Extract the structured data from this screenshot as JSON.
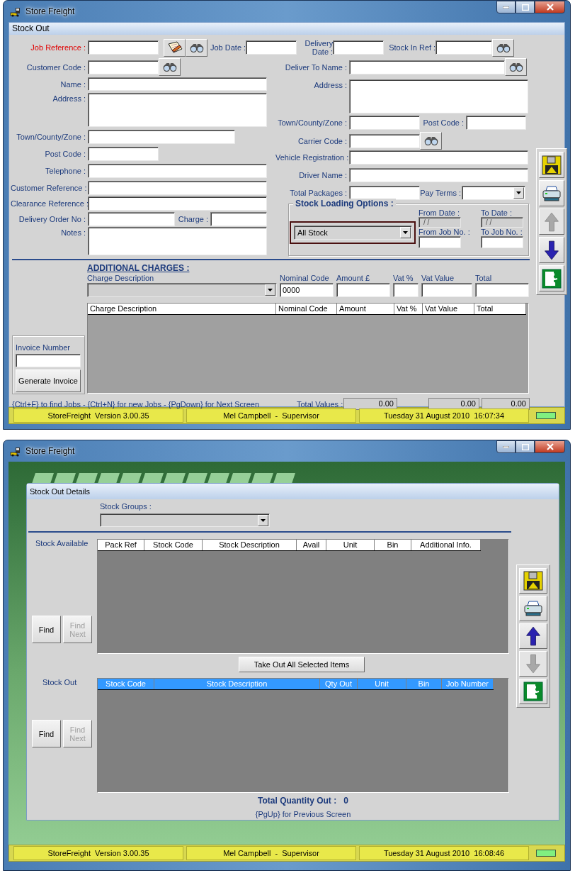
{
  "top_window": {
    "title": "Store Freight",
    "form_title": "Stock Out",
    "left_fields": [
      {
        "label": "Job Reference :",
        "required": true
      },
      {
        "label": "Customer Code :",
        "required": false
      },
      {
        "label": "Name :",
        "required": false
      },
      {
        "label": "Address :",
        "required": false
      },
      {
        "label": "Town/County/Zone :",
        "required": false
      },
      {
        "label": "Post Code :",
        "required": false
      },
      {
        "label": "Telephone :",
        "required": false
      },
      {
        "label": "Customer Reference :",
        "required": false
      },
      {
        "label": "Clearance Reference :",
        "required": false
      },
      {
        "label": "Delivery Order No :",
        "required": false
      },
      {
        "label": "Charge :",
        "required": false
      },
      {
        "label": "Notes :",
        "required": false
      }
    ],
    "right_fields": [
      {
        "label": "Job Date :",
        "required": false
      },
      {
        "label": "Delivery Date :",
        "required": false
      },
      {
        "label": "Stock In Ref :",
        "required": false
      },
      {
        "label": "Deliver To Name :",
        "required": false
      },
      {
        "label": "Address :",
        "required": false
      },
      {
        "label": "Town/County/Zone :",
        "required": false
      },
      {
        "label": "Post Code :",
        "required": false
      },
      {
        "label": "Carrier Code :",
        "required": false
      },
      {
        "label": "Vehicle Registration :",
        "required": false
      },
      {
        "label": "Driver Name :",
        "required": false
      },
      {
        "label": "Total Packages :",
        "required": false
      },
      {
        "label": "Pay Terms :",
        "required": false
      }
    ],
    "stock_loading_options": {
      "title": "Stock Loading Options :",
      "selection": "All Stock",
      "ranges": [
        {
          "label": "From Date :",
          "value": "/ /",
          "disabled": true
        },
        {
          "label": "To Date :",
          "value": "/ /",
          "disabled": true
        },
        {
          "label": "From Job No. :",
          "disabled": false
        },
        {
          "label": "To Job No. :",
          "disabled": false
        }
      ]
    },
    "additional_charges": {
      "title": "ADDITIONAL CHARGES :",
      "charge_select_disabled": true,
      "inputs": [
        {
          "label": "Charge Description"
        },
        {
          "label": "Nominal Code",
          "value": "0000"
        },
        {
          "label": "Amount £"
        },
        {
          "label": "Vat %"
        },
        {
          "label": "Vat Value"
        },
        {
          "label": "Total"
        }
      ],
      "columns": [
        "Charge Description",
        "Nominal Code",
        "Amount",
        "Vat %",
        "Vat Value",
        "Total"
      ],
      "active": false
    },
    "invoice": {
      "label": "Invoice Number",
      "button": "Generate Invoice"
    },
    "hint": "{Ctrl+F} to find Jobs - {Ctrl+N} for new Jobs - {PgDown} for Next Screen",
    "totals": {
      "label": "Total Values :",
      "values": [
        "0.00",
        "0.00",
        "0.00"
      ]
    },
    "toolbar": [
      {
        "kind": "save",
        "disabled": false
      },
      {
        "kind": "print",
        "disabled": false
      },
      {
        "kind": "up",
        "disabled": true
      },
      {
        "kind": "down",
        "disabled": false
      },
      {
        "kind": "exit",
        "disabled": false
      }
    ],
    "status_bar": [
      "StoreFreight  Version 3.00.35",
      "Mel Campbell  -  Supervisor",
      "Tuesday 31 August 2010  16:07:34"
    ]
  },
  "details_window": {
    "title": "Store Freight",
    "form_title": "Stock Out Details",
    "stock_groups": {
      "label": "Stock Groups :",
      "disabled": true
    },
    "grids": [
      {
        "label": "Stock Available",
        "active": false,
        "columns": [
          "Pack Ref",
          "Stock Code",
          "Stock Description",
          "Avail",
          "Unit",
          "Bin",
          "Additional Info."
        ],
        "find": {
          "label": "Find",
          "disabled": false
        },
        "find_next": {
          "label": "Find Next",
          "disabled": true
        }
      },
      {
        "label": "Stock Out",
        "active": true,
        "columns": [
          "Stock Code",
          "Stock Description",
          "Qty Out",
          "Unit",
          "Bin",
          "Job Number"
        ],
        "find": {
          "label": "Find",
          "disabled": false
        },
        "find_next": {
          "label": "Find Next",
          "disabled": true
        }
      }
    ],
    "take_out_button": "Take Out All Selected Items",
    "total_label": "Total Quantity Out :",
    "total_value": "0",
    "hint": "{PgUp} for Previous Screen",
    "toolbar": [
      {
        "kind": "save",
        "disabled": false
      },
      {
        "kind": "print",
        "disabled": false
      },
      {
        "kind": "up",
        "disabled": false
      },
      {
        "kind": "down",
        "disabled": true
      },
      {
        "kind": "exit",
        "disabled": false
      }
    ],
    "status_bar": [
      "StoreFreight  Version 3.00.35",
      "Mel Campbell  -  Supervisor",
      "Tuesday 31 August 2010  16:08:46"
    ]
  }
}
